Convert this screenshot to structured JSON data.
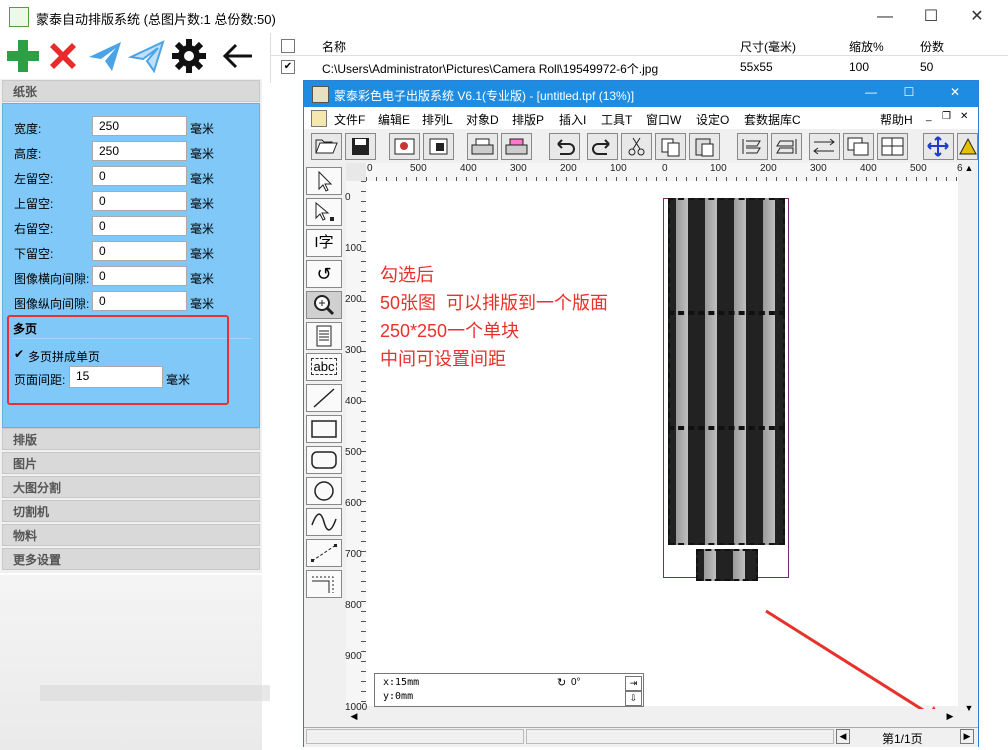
{
  "outer": {
    "title": "蒙泰自动排版系统 (总图片数:1 总份数:50)",
    "min": "—",
    "max": "☐",
    "close": "✕"
  },
  "toolbar": {
    "icons": [
      "add-icon",
      "delete-icon",
      "send-icon",
      "send-outline-icon",
      "gear-icon",
      "back-arrow-icon"
    ]
  },
  "sidebar": {
    "paper_header": "纸张",
    "fields": [
      {
        "label": "宽度:",
        "value": "250",
        "unit": "毫米"
      },
      {
        "label": "高度:",
        "value": "250",
        "unit": "毫米"
      },
      {
        "label": "左留空:",
        "value": "0",
        "unit": "毫米"
      },
      {
        "label": "上留空:",
        "value": "0",
        "unit": "毫米"
      },
      {
        "label": "右留空:",
        "value": "0",
        "unit": "毫米"
      },
      {
        "label": "下留空:",
        "value": "0",
        "unit": "毫米"
      },
      {
        "label": "图像横向间隙:",
        "value": "0",
        "unit": "毫米"
      },
      {
        "label": "图像纵向间隙:",
        "value": "0",
        "unit": "毫米"
      }
    ],
    "multi_header": "多页",
    "multi_check_label": "多页拼成单页",
    "page_gap_label": "页面间距:",
    "page_gap_value": "15",
    "page_gap_unit": "毫米",
    "sections": [
      "排版",
      "图片",
      "大图分割",
      "切割机",
      "物料",
      "更多设置"
    ]
  },
  "filelist": {
    "headers": [
      "名称",
      "尺寸(毫米)",
      "缩放%",
      "份数"
    ],
    "rows": [
      {
        "name": "C:\\Users\\Administrator\\Pictures\\Camera Roll\\19549972-6个.jpg",
        "size": "55x55",
        "scale": "100",
        "count": "50"
      }
    ]
  },
  "inner": {
    "title": "蒙泰彩色电子出版系统 V6.1(专业版) - [untitled.tpf (13%)]",
    "min": "—",
    "max": "☐",
    "close": "✕",
    "menu": [
      "文件F",
      "编辑E",
      "排列L",
      "对象D",
      "排版P",
      "插入I",
      "工具T",
      "窗口W",
      "设定O",
      "套数据库C",
      "帮助H"
    ],
    "top_ruler": [
      "0",
      "500",
      "400",
      "300",
      "200",
      "100",
      "0",
      "100",
      "200",
      "300",
      "400",
      "500",
      "6"
    ],
    "left_ruler": [
      "0",
      "100",
      "200",
      "300",
      "400",
      "500",
      "600",
      "700",
      "800",
      "900",
      "1000"
    ],
    "coord_x": "x:15mm",
    "coord_y": "y:0mm",
    "rotation": "0°",
    "page_indicator": "第1/1页"
  },
  "annotation": {
    "lines": [
      "勾选后",
      "50张图  可以排版到一个版面",
      "250*250一个单块",
      "中间可设置间距"
    ]
  },
  "colors": {
    "accent": "#1e8ce0",
    "panel_blue": "#7fc8f8",
    "red": "#e8312a",
    "green": "#2ea043"
  }
}
